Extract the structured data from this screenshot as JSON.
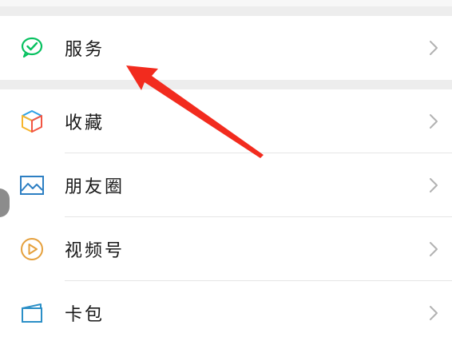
{
  "groups": [
    {
      "items": [
        {
          "label": "服务",
          "icon": "service-wechat-icon"
        }
      ]
    },
    {
      "items": [
        {
          "label": "收藏",
          "icon": "favorites-cube-icon"
        },
        {
          "label": "朋友圈",
          "icon": "moments-picture-icon"
        },
        {
          "label": "视频号",
          "icon": "channels-play-icon"
        },
        {
          "label": "卡包",
          "icon": "card-wallet-icon"
        }
      ]
    }
  ],
  "colors": {
    "background": "#ededed",
    "row": "#ffffff",
    "label": "#191919",
    "chevron": "#b2b2b2",
    "service_green": "#07c160",
    "arrow_red": "#f22b1e"
  }
}
